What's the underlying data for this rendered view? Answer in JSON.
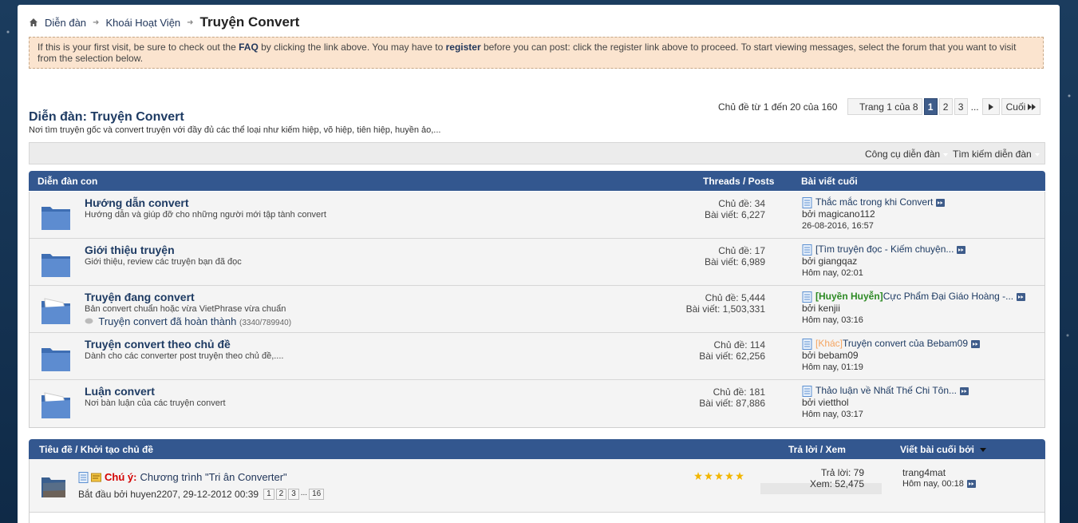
{
  "breadcrumb": {
    "items": [
      "Diễn đàn",
      "Khoái Hoạt Viện"
    ],
    "current": "Truyện Convert"
  },
  "notice": {
    "part1": "If this is your first visit, be sure to check out the ",
    "faq": "FAQ",
    "part2": " by clicking the link above. You may have to ",
    "register": "register",
    "part3": " before you can post: click the register link above to proceed. To start viewing messages, select the forum that you want to visit from the selection below."
  },
  "forum": {
    "title": "Diễn đàn: Truyện Convert",
    "description": "Nơi tìm truyện gốc và convert truyện với đầy đủ các thể loại như kiếm hiệp, võ hiệp, tiên hiệp, huyền ảo,..."
  },
  "pagination": {
    "info": "Chủ đề từ 1 đến 20 của 160",
    "page_of": "Trang 1 của 8",
    "pages": [
      "1",
      "2",
      "3"
    ],
    "dots": "...",
    "last": "Cuối"
  },
  "tools": {
    "forum_tools": "Công cụ diễn đàn",
    "search_forum": "Tìm kiếm diễn đàn"
  },
  "subforums": {
    "header": {
      "col1": "Diễn đàn con",
      "col2": "Threads / Posts",
      "col3": "Bài viết cuối"
    },
    "rows": [
      {
        "title": "Hướng dẫn convert",
        "desc": "Hướng dẫn và giúp đỡ cho những người mới tập tành convert",
        "threads": "Chủ đề: 34",
        "posts": "Bài viết: 6,227",
        "last_prefix": "",
        "last_title": "Thắc mắc trong khi Convert",
        "last_by": "bởi magicano112",
        "last_date": "26-08-2016, 16:57"
      },
      {
        "title": "Giới thiệu truyện",
        "desc": "Giới thiệu, review các truyện bạn đã đọc",
        "threads": "Chủ đề: 17",
        "posts": "Bài viết: 6,989",
        "last_prefix": "",
        "last_title": "[Tìm truyện đọc - Kiếm chuyện...",
        "last_by": "bởi giangqaz",
        "last_date": "Hôm nay, 02:01"
      },
      {
        "title": "Truyện đang convert",
        "desc": "Bản convert chuẩn hoặc vừa VietPhrase vừa chuẩn",
        "sub_title": "Truyện convert đã hoàn thành",
        "sub_count": "(3340/789940)",
        "threads": "Chủ đề: 5,444",
        "posts": "Bài viết: 1,503,331",
        "last_prefix": "[Huyền Huyễn]",
        "last_title": " Cực Phẩm Đại Giáo Hoàng -...",
        "last_by": "bởi kenjii",
        "last_date": "Hôm nay, 03:16"
      },
      {
        "title": "Truyện convert theo chủ đề",
        "desc": "Dành cho các converter post truyện theo chủ đề,....",
        "threads": "Chủ đề: 114",
        "posts": "Bài viết: 62,256",
        "last_prefix": "[Khác]",
        "last_title": " Truyện convert của Bebam09",
        "last_by": "bởi bebam09",
        "last_date": "Hôm nay, 01:19"
      },
      {
        "title": "Luận convert",
        "desc": "Nơi bàn luận của các truyện convert",
        "threads": "Chủ đề: 181",
        "posts": "Bài viết: 87,886",
        "last_prefix": "",
        "last_title": "Thảo luận về Nhất Thế Chi Tôn...",
        "last_by": "bởi vietthol",
        "last_date": "Hôm nay, 03:17"
      }
    ]
  },
  "threads": {
    "header": {
      "col1": "Tiêu đề / Khởi tạo chủ đề",
      "col2": "Trả lời / Xem",
      "col3": "Viết bài cuối bởi"
    },
    "rows": [
      {
        "sticky": "Chú ý:",
        "title": "Chương trình \"Tri ân Converter\"",
        "started_by": "Bắt đầu bởi huyen2207, 29-12-2012 00:39",
        "pages": [
          "1",
          "2",
          "3"
        ],
        "dots": "...",
        "last_page": "16",
        "rating": 5,
        "replies": "Trả lời: 79",
        "views": "Xem: 52,475",
        "last_user": "trang4mat",
        "last_date": "Hôm nay, 00:18"
      }
    ]
  },
  "colors": {
    "header_blue": "#33578f",
    "link_blue": "#1e3b63",
    "notice_bg": "#fbe4cf",
    "sticky_red": "#d40000",
    "prefix_green": "#2d8a24",
    "prefix_orange": "#f4a460",
    "star_gold": "#f2b600"
  },
  "icons": {
    "home": "home-icon",
    "separator": "arrow-separator-icon",
    "folder": "forum-folder-icon",
    "document": "document-icon",
    "goto": "go-to-last-post-icon",
    "star": "star-icon"
  }
}
